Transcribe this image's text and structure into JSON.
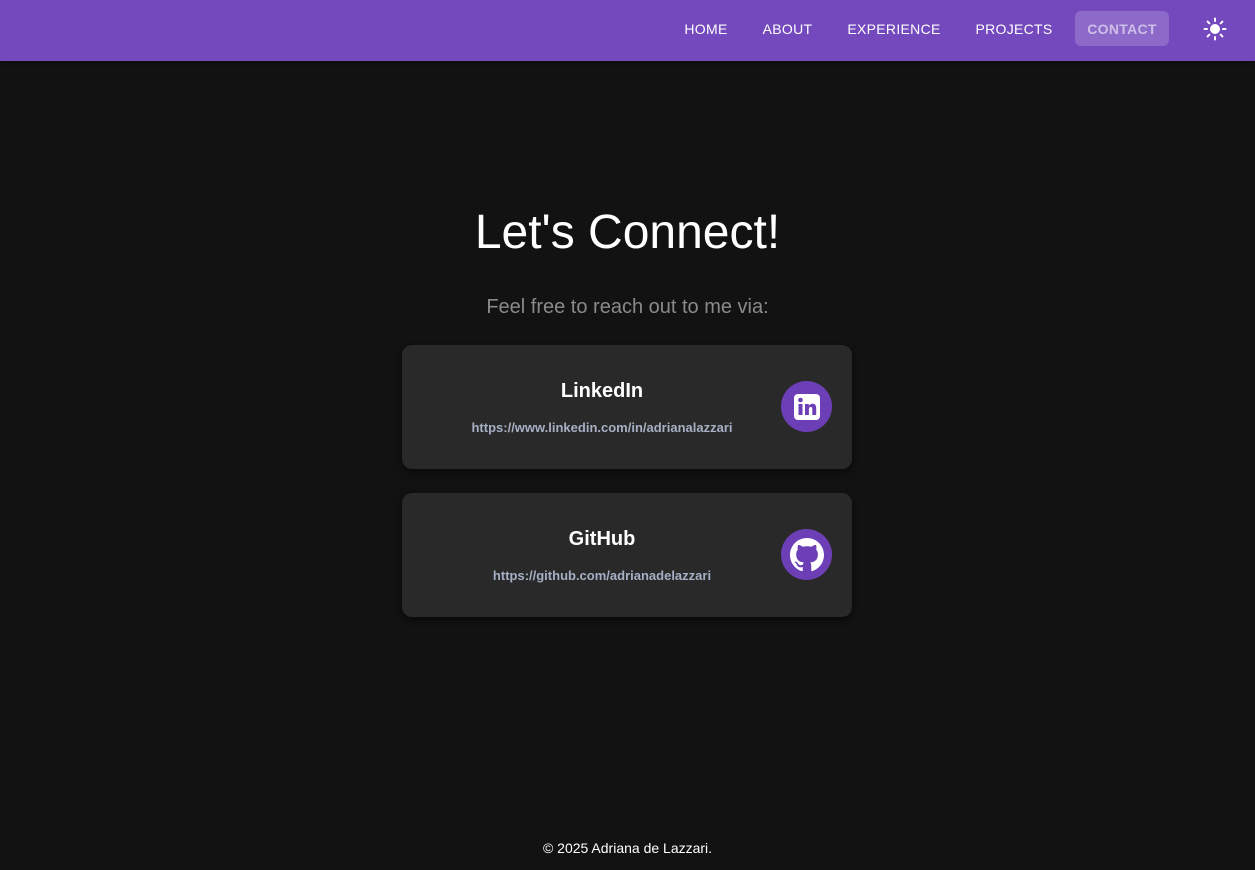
{
  "nav": {
    "items": [
      {
        "label": "HOME"
      },
      {
        "label": "ABOUT"
      },
      {
        "label": "EXPERIENCE"
      },
      {
        "label": "PROJECTS"
      },
      {
        "label": "CONTACT",
        "active": true
      }
    ],
    "theme_toggle_icon": "sun-icon"
  },
  "main": {
    "title": "Let's Connect!",
    "subtitle": "Feel free to reach out to me via:",
    "cards": [
      {
        "title": "LinkedIn",
        "url": "https://www.linkedin.com/in/adrianalazzari",
        "icon": "linkedin-icon"
      },
      {
        "title": "GitHub",
        "url": "https://github.com/adrianadelazzari",
        "icon": "github-icon"
      }
    ]
  },
  "footer": {
    "text": "© 2025 Adriana de Lazzari."
  },
  "colors": {
    "navbar": "#7449bd",
    "background": "#121212",
    "card": "#292929",
    "icon_circle": "#6d3fb6",
    "url_text": "#a6b0c4"
  }
}
